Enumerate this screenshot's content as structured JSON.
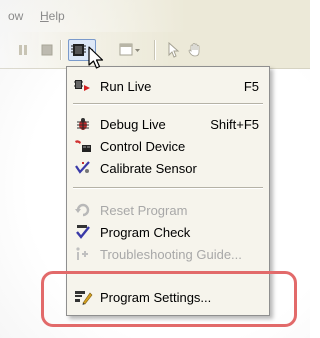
{
  "menubar": {
    "window_label": "ow",
    "help_label": "Help",
    "help_accelerator": "H",
    "help_rest": "elp"
  },
  "toolbar": {
    "buttons": [
      "pause-icon",
      "stop-icon",
      "chip-dropdown-icon",
      "pages-dropdown-icon",
      "arrow-pointer-icon",
      "hand-icon"
    ]
  },
  "menu": {
    "items": [
      {
        "label": "Run Live",
        "shortcut": "F5",
        "icon": "run-live-icon",
        "enabled": true
      },
      {
        "label": "Debug Live",
        "shortcut": "Shift+F5",
        "icon": "bug-icon",
        "enabled": true
      },
      {
        "label": "Control Device",
        "shortcut": "",
        "icon": "control-device-icon",
        "enabled": true
      },
      {
        "label": "Calibrate Sensor",
        "shortcut": "",
        "icon": "calibrate-icon",
        "enabled": true
      },
      {
        "label": "Reset Program",
        "shortcut": "",
        "icon": "reset-icon",
        "enabled": false
      },
      {
        "label": "Program Check",
        "shortcut": "",
        "icon": "program-check-icon",
        "enabled": true
      },
      {
        "label": "Troubleshooting Guide...",
        "shortcut": "",
        "icon": "troubleshoot-icon",
        "enabled": false
      },
      {
        "label": "Program Settings...",
        "shortcut": "",
        "icon": "program-settings-icon",
        "enabled": true
      }
    ]
  },
  "colors": {
    "highlight": "#e26a6a",
    "menu_background": "#f6f4ec",
    "disabled_text": "#a8a8a8"
  }
}
